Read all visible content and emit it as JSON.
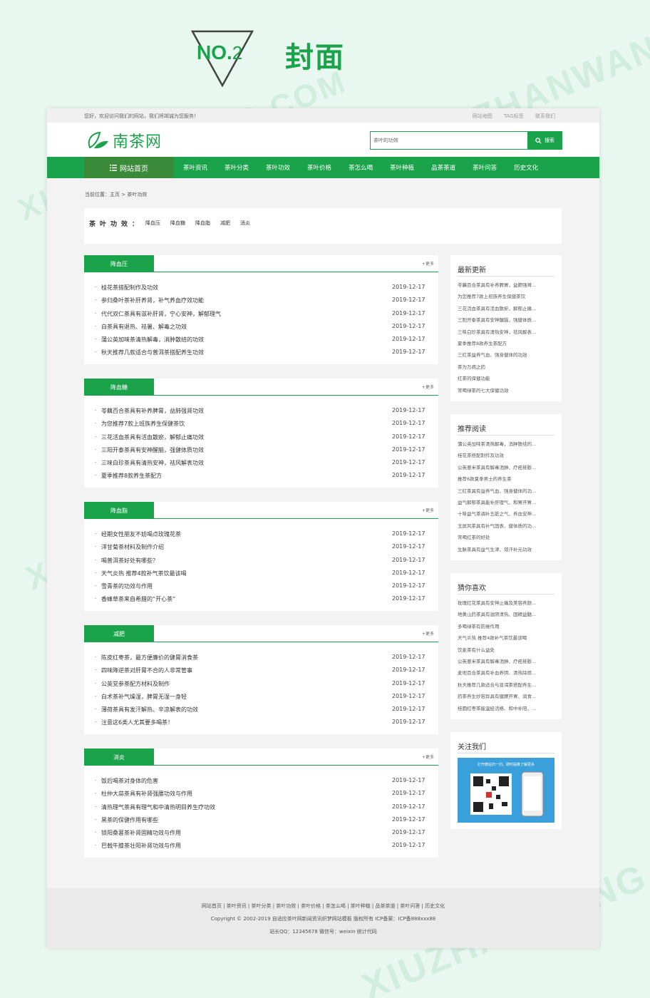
{
  "banner": {
    "no": "NO.",
    "num": "2",
    "title": "封面"
  },
  "watermark": "XIUZHANWANG.COM",
  "topbar": {
    "welcome": "您好，欢迎访问我们的网站，我们将竭诚为您服务！",
    "links": [
      "网站地图",
      "TAG标签",
      "联系我们"
    ]
  },
  "logo": {
    "text": "南茶网"
  },
  "search": {
    "value": "茶叶的功效",
    "button": "搜索"
  },
  "nav": {
    "home": "网站首页",
    "items": [
      "茶叶资讯",
      "茶叶分类",
      "茶叶功效",
      "茶叶价格",
      "茶怎么喝",
      "茶叶种植",
      "品茶茶道",
      "茶叶问答",
      "历史文化"
    ]
  },
  "breadcrumb": "当前位置：主页 > 茶叶功效",
  "filter": {
    "label": "茶叶功效：",
    "tags": [
      "降血压",
      "降血糖",
      "降血脂",
      "减肥",
      "消炎"
    ]
  },
  "more_label": "+更多",
  "sections": [
    {
      "title": "降血压",
      "items": [
        {
          "t": "桂花茶搭配制作及功效",
          "d": "2019-12-17"
        },
        {
          "t": "参归桑叶茶补肝养肾，补气养血疗效功能",
          "d": "2019-12-17"
        },
        {
          "t": "代代双仁茶具有滋补肝肾，宁心安神，解郁理气",
          "d": "2019-12-17"
        },
        {
          "t": "白茶具有退热、祛暑、解毒之功效",
          "d": "2019-12-17"
        },
        {
          "t": "蒲公英加味茶清热解毒，消肿散结的功效",
          "d": "2019-12-17"
        },
        {
          "t": "秋天推荐几款适合与普洱茶搭配养生功效",
          "d": "2019-12-17"
        }
      ]
    },
    {
      "title": "降血糖",
      "items": [
        {
          "t": "苓藕百合茶具有补养脾胃，益肺强肾功效",
          "d": "2019-12-17"
        },
        {
          "t": "为您推荐7款上班族养生保健茶饮",
          "d": "2019-12-17"
        },
        {
          "t": "三花活血茶具有活血散瘀，解郁止痛功效",
          "d": "2019-12-17"
        },
        {
          "t": "三阳开泰茶具有安神醒脑，强健体质功效",
          "d": "2019-12-17"
        },
        {
          "t": "三味白珍茶具有清热安神，祛风解表功效",
          "d": "2019-12-17"
        },
        {
          "t": "夏季推荐8款养生茶配方",
          "d": "2019-12-17"
        }
      ]
    },
    {
      "title": "降血脂",
      "items": [
        {
          "t": "经期女性朋友不妨喝点玫瑰花茶",
          "d": "2019-12-17"
        },
        {
          "t": "洋甘菊茶材料及制作介绍",
          "d": "2019-12-17"
        },
        {
          "t": "喝普洱茶好处有哪些？",
          "d": "2019-12-17"
        },
        {
          "t": "天气炎热 推荐4款补气茶饮最该喝",
          "d": "2019-12-17"
        },
        {
          "t": "雪青茶的功效与作用",
          "d": "2019-12-17"
        },
        {
          "t": "香蜂草茶来自希腊的“开心茶”",
          "d": "2019-12-17"
        }
      ]
    },
    {
      "title": "减肥",
      "items": [
        {
          "t": "陈皮红枣茶，最方便廉价的健胃消食茶",
          "d": "2019-12-17"
        },
        {
          "t": "四味降逆茶对肝胃不合的人非常管事",
          "d": "2019-12-17"
        },
        {
          "t": "公英党参茶配方材料及制作",
          "d": "2019-12-17"
        },
        {
          "t": "白术茶补气燥湿，脾胃无湿一身轻",
          "d": "2019-12-17"
        },
        {
          "t": "薄荷茶具有发汗解热、辛凉解表的功效",
          "d": "2019-12-17"
        },
        {
          "t": "注意这6类人尤其要多喝茶！",
          "d": "2019-12-17"
        }
      ]
    },
    {
      "title": "消炎",
      "items": [
        {
          "t": "饭后喝茶对身体的危害",
          "d": "2019-12-17"
        },
        {
          "t": "杜仲大蒜茶具有补肾强腰功效与作用",
          "d": "2019-12-17"
        },
        {
          "t": "清热理气茶具有理气和中清热明目养生疗功效",
          "d": "2019-12-17"
        },
        {
          "t": "黑茶的保健作用有哪些",
          "d": "2019-12-17"
        },
        {
          "t": "锁阳桑葚茶补肾固精功效与作用",
          "d": "2019-12-17"
        },
        {
          "t": "巴戟牛膝茶壮阳补肾功效与作用",
          "d": "2019-12-17"
        }
      ]
    }
  ],
  "sidebar": [
    {
      "title": "最新更新",
      "items": [
        "苓藕百合茶具有补养脾胃，益肺强肾...",
        "为您推荐7款上班族养生保健茶饮",
        "三花活血茶具有活血散瘀，解郁止痛...",
        "三阳开泰茶具有安神醒脑，强健体质...",
        "三味白珍茶具有清热安神，祛风解表...",
        "夏季推荐8款养生茶配方",
        "三红茶益养气血、强身健体的功效",
        "茶为万病之药",
        "红茶的保健功能",
        "常喝绿茶的七大保健功效"
      ]
    },
    {
      "title": "推荐阅读",
      "items": [
        "蒲公英加味茶清热解毒，消肿散结的...",
        "桂花茶搭配制作及功效",
        "公英薏米茶具有解毒消肿、疗疮排脓...",
        "推荐6款夏季男士的养生茶",
        "三红茶具有益养气血、强身健体的功...",
        "益气解郁茶具能补肝理气、和胃开胃...",
        "十味益气茶调补五脏之气、养血安神...",
        "玉屏风茶具有补气固表、健体质的功...",
        "常喝红茶的好处",
        "生脉茶具有益气生津、敛汗补元功效"
      ]
    },
    {
      "title": "猜你喜欢",
      "items": [
        "玫瑰红花茶具有安神止痛及美容养颜...",
        "地黄山药茶具有滋阴清热、固精益髓...",
        "多喝绿茶有防癌作用",
        "天气炎热 推荐4款补气茶饮最该喝",
        "饮麦茶有什么益处",
        "公英薏米茶具有解毒消肿、疗疮排脓...",
        "麦地百合茶具有补血养阴、清热除烦...",
        "秋天推荐几款适合与普洱茶搭配养生...",
        "药茶养生妙容异具有健脾开胃、润食...",
        "桂圆红枣茶能温经活络、和中补阳，..."
      ]
    },
    {
      "title": "关注我们",
      "qr_text": "打开微信扫一扫，即时提推了解更多"
    }
  ],
  "footer": {
    "links": "网站首页 | 茶叶资讯 | 茶叶分类 | 茶叶功效 | 茶叶价格 | 茶怎么喝 | 茶叶种植 | 品茶茶道 | 茶叶问答 | 历史文化",
    "copyright": "Copyright © 2002-2019 自适应茶叶网新闻资讯织梦网站模板 版权所有  ICP备案：ICP备888xxx88",
    "contact": "站长QQ：12345678 微信号：weixin 统计代码"
  },
  "colors": {
    "brand": "#1aa34a",
    "home_bg": "#3a8a3a",
    "page_bg": "#e8f7ef"
  }
}
